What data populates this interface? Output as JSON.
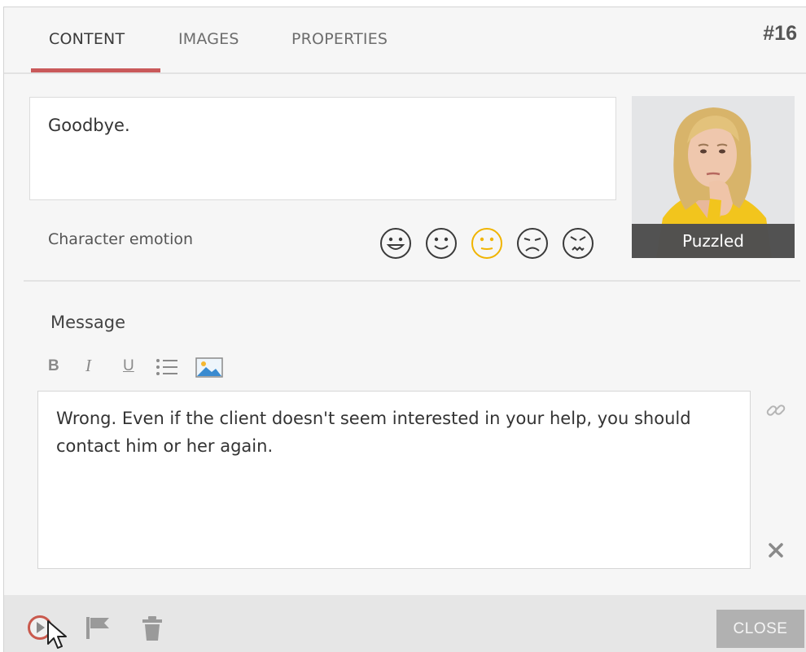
{
  "tabs": [
    {
      "label": "CONTENT",
      "active": true
    },
    {
      "label": "IMAGES",
      "active": false
    },
    {
      "label": "PROPERTIES",
      "active": false
    }
  ],
  "item_number": "#16",
  "top_text": "Goodbye.",
  "character": {
    "caption": "Puzzled"
  },
  "emotion": {
    "label": "Character emotion",
    "options": [
      "very-happy",
      "happy",
      "puzzled",
      "sad",
      "angry"
    ],
    "selected": "puzzled",
    "selected_color": "#f0b400",
    "default_color": "#3a3a3a"
  },
  "message": {
    "label": "Message",
    "toolbar": {
      "bold": "B",
      "italic": "I",
      "underline": "U"
    },
    "text": "Wrong. Even if the client doesn't seem interested in your help, you should contact him or her again."
  },
  "footer": {
    "close_label": "CLOSE"
  },
  "colors": {
    "accent": "#c9595a",
    "play_ring": "#c9594d",
    "close_button": "#b1b1b1"
  }
}
